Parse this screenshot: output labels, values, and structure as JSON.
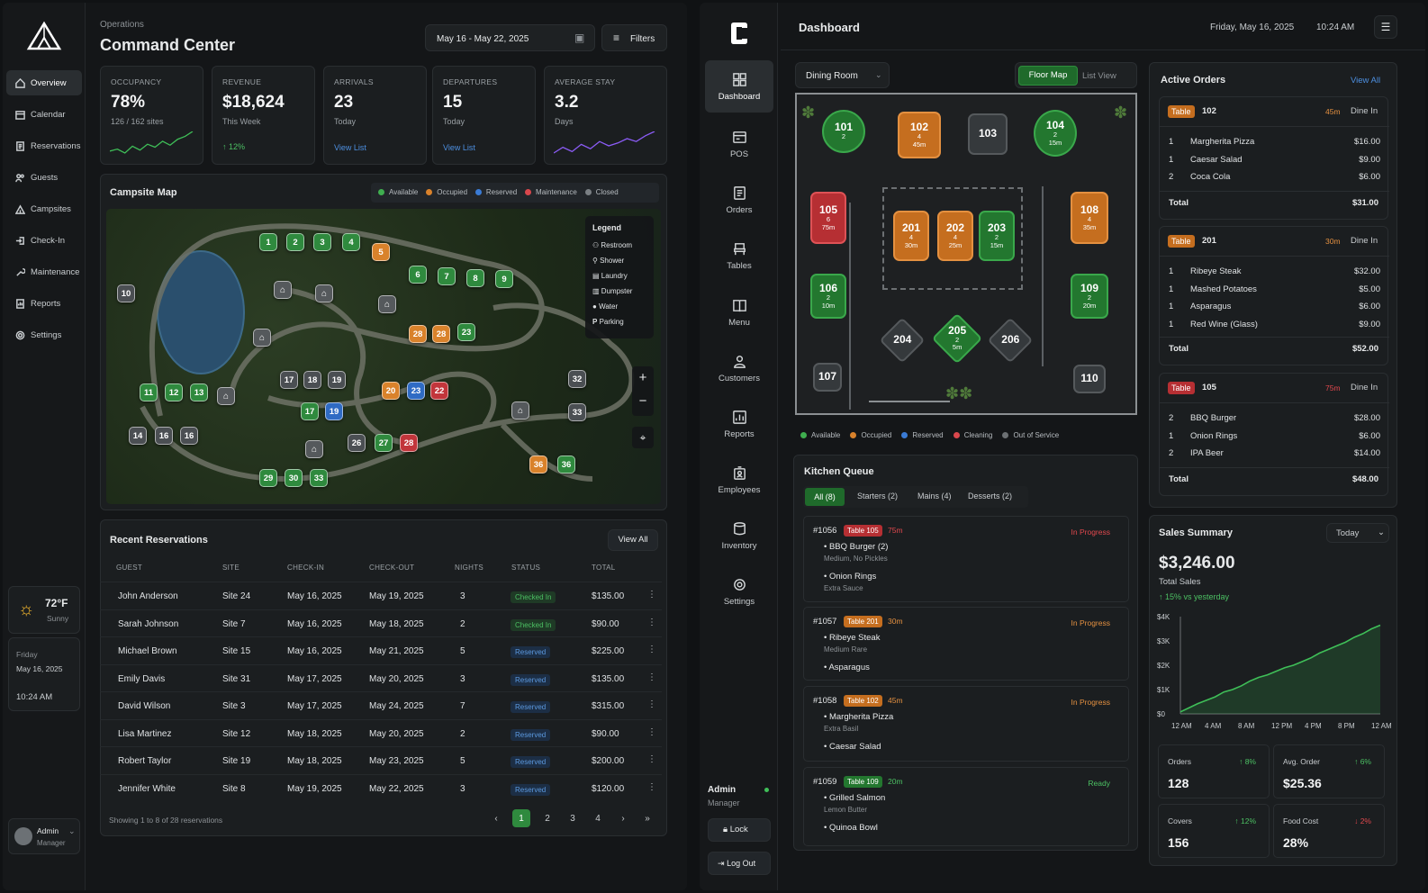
{
  "campground": {
    "header": {
      "section": "Operations",
      "title": "Command Center",
      "date_range": "May 16 - May 22, 2025",
      "filters": "Filters"
    },
    "nav": [
      "Overview",
      "Calendar",
      "Reservations",
      "Guests",
      "Campsites",
      "Check-In",
      "Maintenance",
      "Reports",
      "Settings"
    ],
    "kpis": [
      {
        "label": "OCCUPANCY",
        "value": "78%",
        "sub": "126 / 162 sites"
      },
      {
        "label": "REVENUE",
        "value": "$18,624",
        "sub": "This Week",
        "delta": "↑ 12%"
      },
      {
        "label": "ARRIVALS",
        "value": "23",
        "sub": "Today",
        "link": "View List"
      },
      {
        "label": "DEPARTURES",
        "value": "15",
        "sub": "Today",
        "link": "View List"
      },
      {
        "label": "AVERAGE STAY",
        "value": "3.2",
        "sub": "Days"
      }
    ],
    "map": {
      "title": "Campsite Map",
      "status_legend": [
        "Available",
        "Occupied",
        "Reserved",
        "Maintenance",
        "Closed"
      ],
      "legend_title": "Legend",
      "legend": [
        "Restroom",
        "Shower",
        "Laundry",
        "Dumpster",
        "Water",
        "Parking"
      ],
      "sites": [
        {
          "n": "1",
          "s": "av"
        },
        {
          "n": "2",
          "s": "av"
        },
        {
          "n": "3",
          "s": "av"
        },
        {
          "n": "4",
          "s": "av"
        },
        {
          "n": "5",
          "s": "oc"
        },
        {
          "n": "6",
          "s": "av"
        },
        {
          "n": "7",
          "s": "av"
        },
        {
          "n": "8",
          "s": "av"
        },
        {
          "n": "9",
          "s": "av"
        },
        {
          "n": "10",
          "s": "cl"
        },
        {
          "n": "11",
          "s": "av"
        },
        {
          "n": "12",
          "s": "av"
        },
        {
          "n": "13",
          "s": "av"
        },
        {
          "n": "14",
          "s": "cl"
        },
        {
          "n": "16",
          "s": "cl"
        },
        {
          "n": "16",
          "s": "cl"
        },
        {
          "n": "17",
          "s": "cl"
        },
        {
          "n": "18",
          "s": "cl"
        },
        {
          "n": "19",
          "s": "cl"
        },
        {
          "n": "17",
          "s": "av"
        },
        {
          "n": "19",
          "s": "re"
        },
        {
          "n": "20",
          "s": "oc"
        },
        {
          "n": "23",
          "s": "re"
        },
        {
          "n": "22",
          "s": "ma"
        },
        {
          "n": "28",
          "s": "oc"
        },
        {
          "n": "28",
          "s": "oc"
        },
        {
          "n": "23",
          "s": "av"
        },
        {
          "n": "26",
          "s": "cl"
        },
        {
          "n": "27",
          "s": "av"
        },
        {
          "n": "28",
          "s": "ma"
        },
        {
          "n": "29",
          "s": "av"
        },
        {
          "n": "30",
          "s": "av"
        },
        {
          "n": "33",
          "s": "av"
        },
        {
          "n": "32",
          "s": "cl"
        },
        {
          "n": "33",
          "s": "cl"
        },
        {
          "n": "36",
          "s": "oc"
        },
        {
          "n": "36",
          "s": "av"
        }
      ]
    },
    "reservations": {
      "title": "Recent Reservations",
      "view_all": "View All",
      "columns": [
        "GUEST",
        "SITE",
        "CHECK-IN",
        "CHECK-OUT",
        "NIGHTS",
        "STATUS",
        "TOTAL"
      ],
      "rows": [
        [
          "John Anderson",
          "Site 24",
          "May 16, 2025",
          "May 19, 2025",
          "3",
          "Checked In",
          "$135.00"
        ],
        [
          "Sarah Johnson",
          "Site 7",
          "May 16, 2025",
          "May 18, 2025",
          "2",
          "Checked In",
          "$90.00"
        ],
        [
          "Michael Brown",
          "Site 15",
          "May 16, 2025",
          "May 21, 2025",
          "5",
          "Reserved",
          "$225.00"
        ],
        [
          "Emily Davis",
          "Site 31",
          "May 17, 2025",
          "May 20, 2025",
          "3",
          "Reserved",
          "$135.00"
        ],
        [
          "David Wilson",
          "Site 3",
          "May 17, 2025",
          "May 24, 2025",
          "7",
          "Reserved",
          "$315.00"
        ],
        [
          "Lisa Martinez",
          "Site 12",
          "May 18, 2025",
          "May 20, 2025",
          "2",
          "Reserved",
          "$90.00"
        ],
        [
          "Robert Taylor",
          "Site 19",
          "May 18, 2025",
          "May 23, 2025",
          "5",
          "Reserved",
          "$200.00"
        ],
        [
          "Jennifer White",
          "Site 8",
          "May 19, 2025",
          "May 22, 2025",
          "3",
          "Reserved",
          "$120.00"
        ]
      ],
      "showing": "Showing 1 to 8 of 28 reservations",
      "pages": [
        "1",
        "2",
        "3",
        "4"
      ]
    },
    "weather": {
      "temp": "72°F",
      "cond": "Sunny"
    },
    "datebox": {
      "day": "Friday",
      "date": "May 16, 2025",
      "time": "10:24 AM"
    },
    "user": {
      "name": "Admin",
      "role": "Manager"
    }
  },
  "restaurant": {
    "header": {
      "title": "Dashboard",
      "date": "Friday, May 16, 2025",
      "time": "10:24 AM"
    },
    "nav": [
      "Dashboard",
      "POS",
      "Orders",
      "Tables",
      "Menu",
      "Customers",
      "Reports",
      "Employees",
      "Inventory",
      "Settings"
    ],
    "room": "Dining Room",
    "view_tabs": [
      "Floor Map",
      "List View"
    ],
    "tables": [
      {
        "n": "101",
        "g": "2",
        "s": "av"
      },
      {
        "n": "102",
        "g": "4",
        "t": "45m",
        "s": "oc"
      },
      {
        "n": "103",
        "s": "cl"
      },
      {
        "n": "104",
        "g": "2",
        "t": "15m",
        "s": "av"
      },
      {
        "n": "105",
        "g": "6",
        "t": "75m",
        "s": "re"
      },
      {
        "n": "201",
        "g": "4",
        "t": "30m",
        "s": "oc"
      },
      {
        "n": "202",
        "g": "4",
        "t": "25m",
        "s": "oc"
      },
      {
        "n": "203",
        "g": "2",
        "t": "15m",
        "s": "av"
      },
      {
        "n": "108",
        "g": "4",
        "t": "35m",
        "s": "oc"
      },
      {
        "n": "106",
        "g": "2",
        "t": "10m",
        "s": "av"
      },
      {
        "n": "109",
        "g": "2",
        "t": "20m",
        "s": "av"
      },
      {
        "n": "204",
        "s": "cl"
      },
      {
        "n": "205",
        "g": "2",
        "t": "5m",
        "s": "av"
      },
      {
        "n": "206",
        "s": "cl"
      },
      {
        "n": "107",
        "s": "cl"
      },
      {
        "n": "110",
        "s": "cl"
      }
    ],
    "floor_legend": [
      "Available",
      "Occupied",
      "Reserved",
      "Cleaning",
      "Out of Service"
    ],
    "active_orders": {
      "title": "Active Orders",
      "view_all": "View All",
      "orders": [
        {
          "table_label": "Table",
          "table": "102",
          "time": "45m",
          "type": "Dine In",
          "items": [
            [
              "1",
              "Margherita Pizza",
              "$16.00"
            ],
            [
              "1",
              "Caesar Salad",
              "$9.00"
            ],
            [
              "2",
              "Coca Cola",
              "$6.00"
            ]
          ],
          "total": "$31.00"
        },
        {
          "table_label": "Table",
          "table": "201",
          "time": "30m",
          "type": "Dine In",
          "items": [
            [
              "1",
              "Ribeye Steak",
              "$32.00"
            ],
            [
              "1",
              "Mashed Potatoes",
              "$5.00"
            ],
            [
              "1",
              "Asparagus",
              "$6.00"
            ],
            [
              "1",
              "Red Wine (Glass)",
              "$9.00"
            ]
          ],
          "total": "$52.00"
        },
        {
          "table_label": "Table",
          "table": "105",
          "time": "75m",
          "type": "Dine In",
          "items": [
            [
              "2",
              "BBQ Burger",
              "$28.00"
            ],
            [
              "1",
              "Onion Rings",
              "$6.00"
            ],
            [
              "2",
              "IPA Beer",
              "$14.00"
            ]
          ],
          "total": "$48.00"
        }
      ],
      "total_label": "Total"
    },
    "kitchen": {
      "title": "Kitchen Queue",
      "tabs": [
        "All (8)",
        "Starters (2)",
        "Mains (4)",
        "Desserts (2)"
      ],
      "tickets": [
        {
          "id": "#1056",
          "table": "Table 105",
          "time": "75m",
          "status": "In Progress",
          "items": [
            [
              "BBQ Burger (2)",
              "Medium, No Pickles"
            ],
            [
              "Onion Rings",
              "Extra Sauce"
            ]
          ]
        },
        {
          "id": "#1057",
          "table": "Table 201",
          "time": "30m",
          "status": "In Progress",
          "items": [
            [
              "Ribeye Steak",
              "Medium Rare"
            ],
            [
              "Asparagus",
              ""
            ]
          ]
        },
        {
          "id": "#1058",
          "table": "Table 102",
          "time": "45m",
          "status": "In Progress",
          "items": [
            [
              "Margherita Pizza",
              "Extra Basil"
            ],
            [
              "Caesar Salad",
              ""
            ]
          ]
        },
        {
          "id": "#1059",
          "table": "Table 109",
          "time": "20m",
          "status": "Ready",
          "items": [
            [
              "Grilled Salmon",
              "Lemon Butter"
            ],
            [
              "Quinoa Bowl",
              ""
            ]
          ]
        }
      ]
    },
    "sales": {
      "title": "Sales Summary",
      "period": "Today",
      "value": "$3,246.00",
      "label": "Total Sales",
      "delta": "↑ 15% vs yesterday",
      "stats": [
        {
          "t": "Orders",
          "v": "128",
          "d": "↑ 8%"
        },
        {
          "t": "Avg. Order",
          "v": "$25.36",
          "d": "↑ 6%"
        },
        {
          "t": "Covers",
          "v": "156",
          "d": "↑ 12%"
        },
        {
          "t": "Food Cost",
          "v": "28%",
          "d": "↓ 2%"
        }
      ]
    },
    "user": {
      "name": "Admin",
      "role": "Manager",
      "lock": "Lock",
      "logout": "Log Out"
    }
  },
  "chart_data": {
    "type": "area",
    "x": [
      "12 AM",
      "4 AM",
      "8 AM",
      "12 PM",
      "4 PM",
      "8 PM",
      "12 AM"
    ],
    "yticks": [
      "$4K",
      "$3K",
      "$2K",
      "$1K",
      "$0"
    ],
    "ylim": [
      0,
      4000
    ],
    "series": [
      {
        "values": [
          80,
          250,
          420,
          560,
          700,
          900,
          1000,
          1150,
          1350,
          1500,
          1600,
          1750,
          1900,
          2000,
          2150,
          2300,
          2500,
          2650,
          2800,
          2950,
          3150,
          3300,
          3500,
          3650
        ]
      }
    ],
    "xlabel": "",
    "ylabel": ""
  },
  "sparklines": {
    "occupancy": [
      40,
      42,
      38,
      45,
      41,
      47,
      44,
      50,
      46,
      52,
      55,
      60
    ],
    "avgstay": [
      30,
      34,
      31,
      36,
      33,
      38,
      35,
      37,
      40,
      38,
      42,
      45
    ]
  },
  "colors": {
    "available": "#2f8a3e",
    "occupied": "#d9822b",
    "reserved": "#2f6bc4",
    "maintenance": "#c2353b",
    "closed": "#4b4f53",
    "accent_green": "#4cc063"
  }
}
